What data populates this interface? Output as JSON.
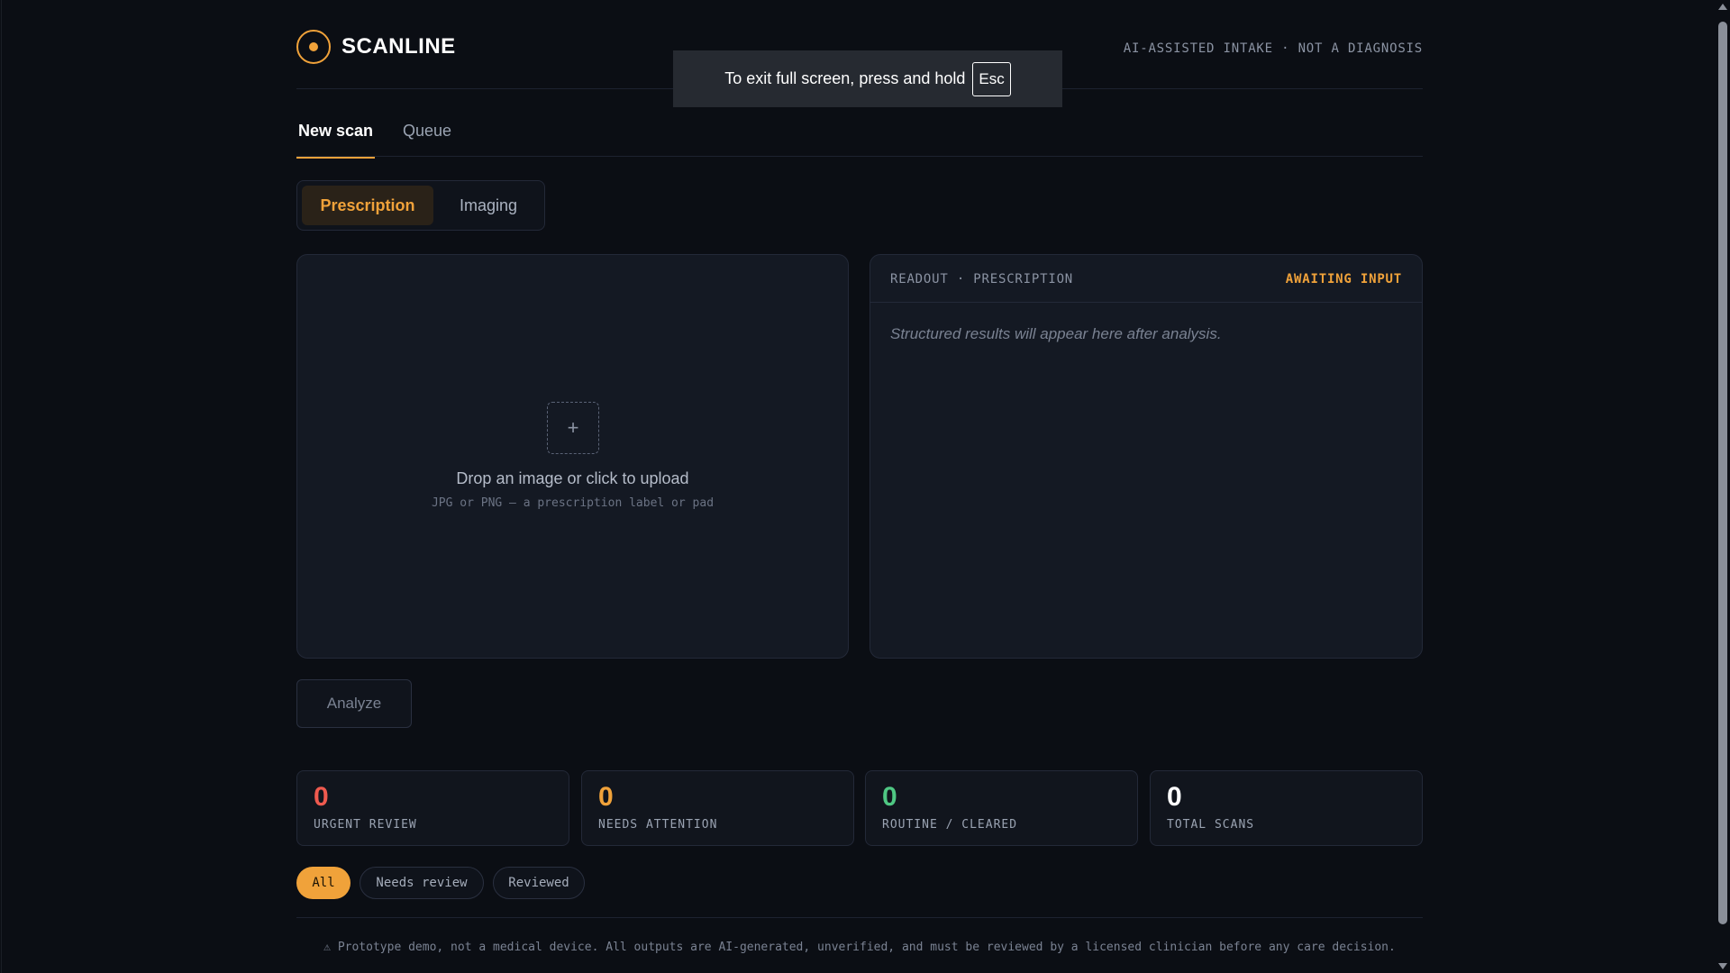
{
  "brand": {
    "name": "SCANLINE"
  },
  "header": {
    "note": "AI-ASSISTED INTAKE · NOT A DIAGNOSIS"
  },
  "tabs": [
    {
      "label": "New scan",
      "active": true
    },
    {
      "label": "Queue",
      "active": false
    }
  ],
  "mode_toggle": {
    "options": [
      "Prescription",
      "Imaging"
    ],
    "selected": "Prescription"
  },
  "upload": {
    "icon": "plus-icon",
    "title": "Drop an image or click to upload",
    "subtitle": "JPG or PNG — a prescription label or pad"
  },
  "readout": {
    "label": "READOUT · PRESCRIPTION",
    "status": "AWAITING INPUT",
    "empty_text": "Structured results will appear here after analysis."
  },
  "analyze_button": {
    "label": "Analyze",
    "disabled": true
  },
  "stats": [
    {
      "value": "0",
      "label": "URGENT REVIEW",
      "color": "#ef5a4f"
    },
    {
      "value": "0",
      "label": "NEEDS ATTENTION",
      "color": "#f0a23a"
    },
    {
      "value": "0",
      "label": "ROUTINE / CLEARED",
      "color": "#4fc783"
    },
    {
      "value": "0",
      "label": "TOTAL SCANS",
      "color": "#ffffff"
    }
  ],
  "filters": [
    {
      "label": "All",
      "active": true
    },
    {
      "label": "Needs review",
      "active": false
    },
    {
      "label": "Reviewed",
      "active": false
    }
  ],
  "footer": {
    "text": "⚠ Prototype demo, not a medical device. All outputs are AI-generated, unverified, and must be reviewed by a licensed clinician before any care decision."
  },
  "fullscreen_toast": {
    "text": "To exit full screen, press and hold",
    "key": "Esc"
  },
  "colors": {
    "accent": "#f0a23a",
    "background": "#0b0e14",
    "panel": "#141923"
  }
}
